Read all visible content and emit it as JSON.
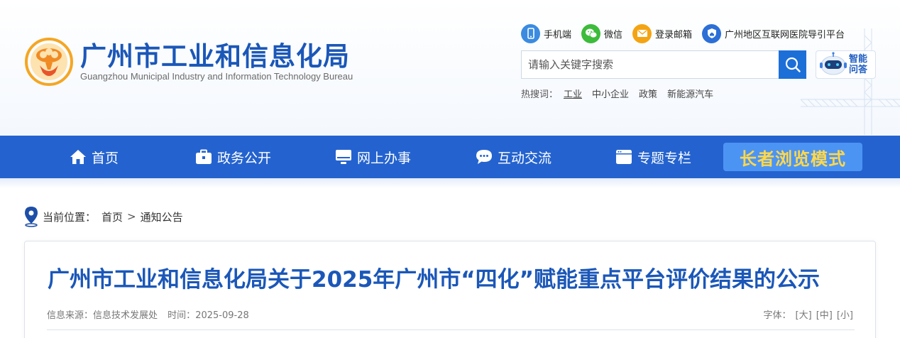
{
  "brand": {
    "title": "广州市工业和信息化局",
    "subtitle": "Guangzhou Municipal Industry and Information Technology Bureau"
  },
  "toplinks": [
    {
      "label": "手机端",
      "icon": "mobile-icon",
      "color": "#3b8be0"
    },
    {
      "label": "微信",
      "icon": "wechat-icon",
      "color": "#3dbb3b"
    },
    {
      "label": "登录邮箱",
      "icon": "mail-icon",
      "color": "#f4a413"
    },
    {
      "label": "广州地区互联网医院导引平台",
      "icon": "shield-home-icon",
      "color": "#2c6fd6"
    }
  ],
  "search": {
    "placeholder": "请输入关键字搜索",
    "value": ""
  },
  "qa": {
    "line1": "智能",
    "line2": "问答"
  },
  "hotwords": {
    "label": "热搜词：",
    "items": [
      "工业",
      "中小企业",
      "政策",
      "新能源汽车"
    ]
  },
  "nav": {
    "items": [
      {
        "label": "首页",
        "icon": "home-icon"
      },
      {
        "label": "政务公开",
        "icon": "briefcase-icon"
      },
      {
        "label": "网上办事",
        "icon": "monitor-icon"
      },
      {
        "label": "互动交流",
        "icon": "chat-icon"
      },
      {
        "label": "专题专栏",
        "icon": "window-icon"
      }
    ],
    "elder_mode": "长者浏览模式"
  },
  "breadcrumb": {
    "label": "当前位置：",
    "items": [
      "首页",
      "通知公告"
    ],
    "separator": ">"
  },
  "article": {
    "title": "广州市工业和信息化局关于2025年广州市“四化”赋能重点平台评价结果的公示",
    "source_label": "信息来源：",
    "source": "信息技术发展处",
    "time_label": "时间：",
    "time": "2025-09-28",
    "font_label": "字体：",
    "font_sizes": [
      "[大]",
      "[中]",
      "[小]"
    ]
  },
  "colors": {
    "brand_blue": "#1b57b8",
    "nav_blue": "#2463cf",
    "elder_bg": "#4c94f4",
    "elder_text": "#ffd84a",
    "search_btn": "#1d6fd8"
  }
}
